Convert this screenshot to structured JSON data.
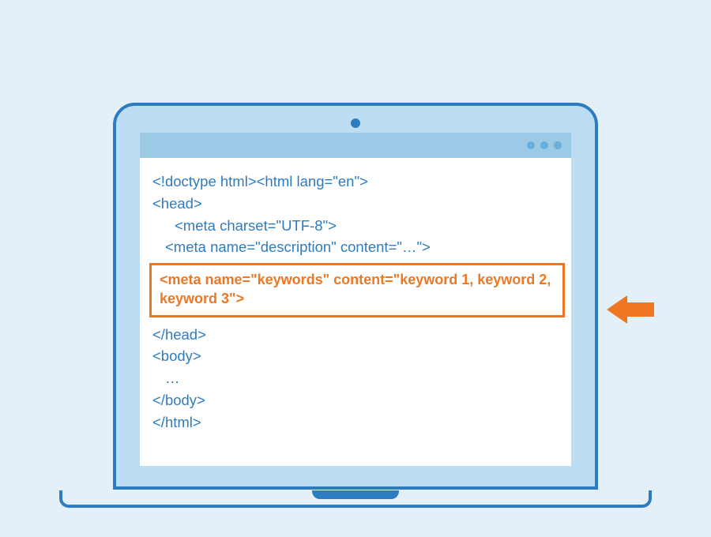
{
  "code": {
    "line1": "<!doctype html><html lang=\"en\">",
    "line2": "<head>",
    "line3": "<meta charset=\"UTF-8\">",
    "line4": "<meta name=\"description\" content=\"…\">",
    "highlighted": "<meta name=\"keywords\" content=\"keyword 1, keyword 2, keyword 3\">",
    "line5": "</head>",
    "line6": "<body>",
    "line7": "…",
    "line8": "</body>",
    "line9": "</html>"
  },
  "colors": {
    "background": "#e4f0f8",
    "laptop_stroke": "#2d7cc1",
    "laptop_fill": "#bdddf2",
    "titlebar": "#9cc9e6",
    "code_text": "#2d7cc1",
    "highlight": "#ef7722"
  }
}
